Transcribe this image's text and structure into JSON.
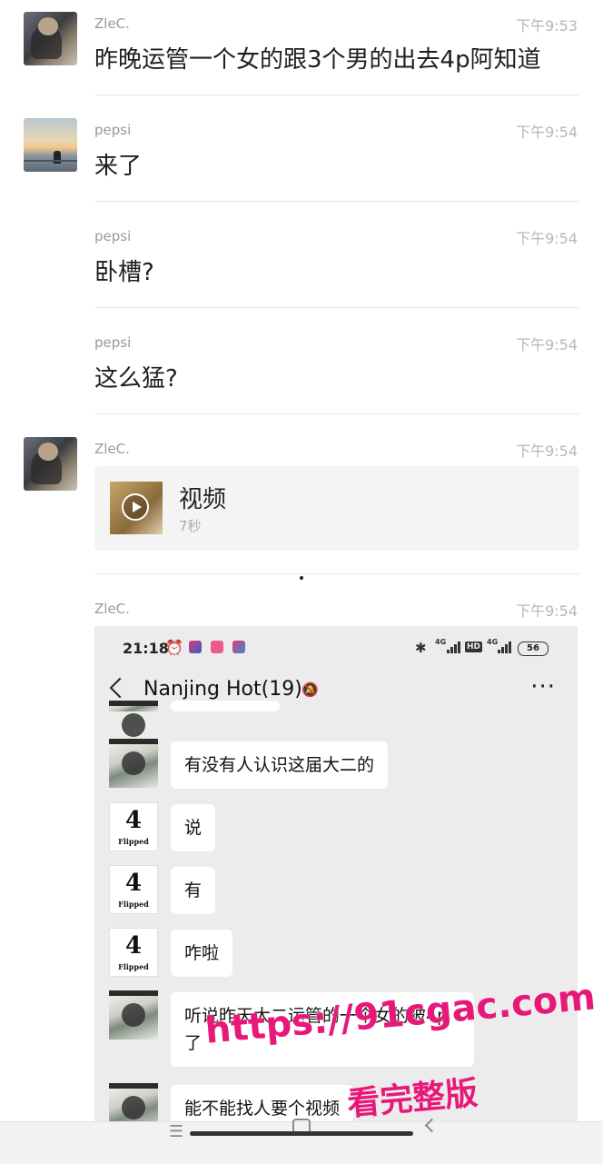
{
  "messages": [
    {
      "sender": "ZleC.",
      "time": "下午9:53",
      "text": "昨晚运管一个女的跟3个男的出去4p阿知道"
    },
    {
      "sender": "pepsi",
      "time": "下午9:54",
      "text": "来了"
    },
    {
      "sender": "pepsi",
      "time": "下午9:54",
      "text": "卧槽?"
    },
    {
      "sender": "pepsi",
      "time": "下午9:54",
      "text": "这么猛?"
    },
    {
      "sender": "ZleC.",
      "time": "下午9:54",
      "video_title": "视频",
      "video_duration": "7秒"
    },
    {
      "sender": "ZleC.",
      "time": "下午9:54"
    }
  ],
  "screenshot": {
    "status_time": "21:18",
    "net_label_1": "4G",
    "net_label_2": "4G",
    "hd_label": "HD",
    "battery": "56",
    "chat_title": "Nanjing Hot(19)",
    "more_icon": "···",
    "bubbles": [
      {
        "text": "有没有人认识这届大二的",
        "avatar": "money"
      },
      {
        "text": "说",
        "avatar": "flipped"
      },
      {
        "text": "有",
        "avatar": "flipped"
      },
      {
        "text": "咋啦",
        "avatar": "flipped"
      },
      {
        "text": "听说昨天大二运管的一个女的被4p了",
        "avatar": "money"
      },
      {
        "text": "能不能找人要个视频",
        "avatar": "money"
      }
    ],
    "flipped_glyph": "4",
    "flipped_caption": "Flipped"
  },
  "watermark": {
    "line1": "https://91cgac.com",
    "line2": "看完整版"
  },
  "colors": {
    "watermark": "#e8187a",
    "time_gray": "#b7b7b7",
    "name_gray": "#9a9a9a"
  }
}
